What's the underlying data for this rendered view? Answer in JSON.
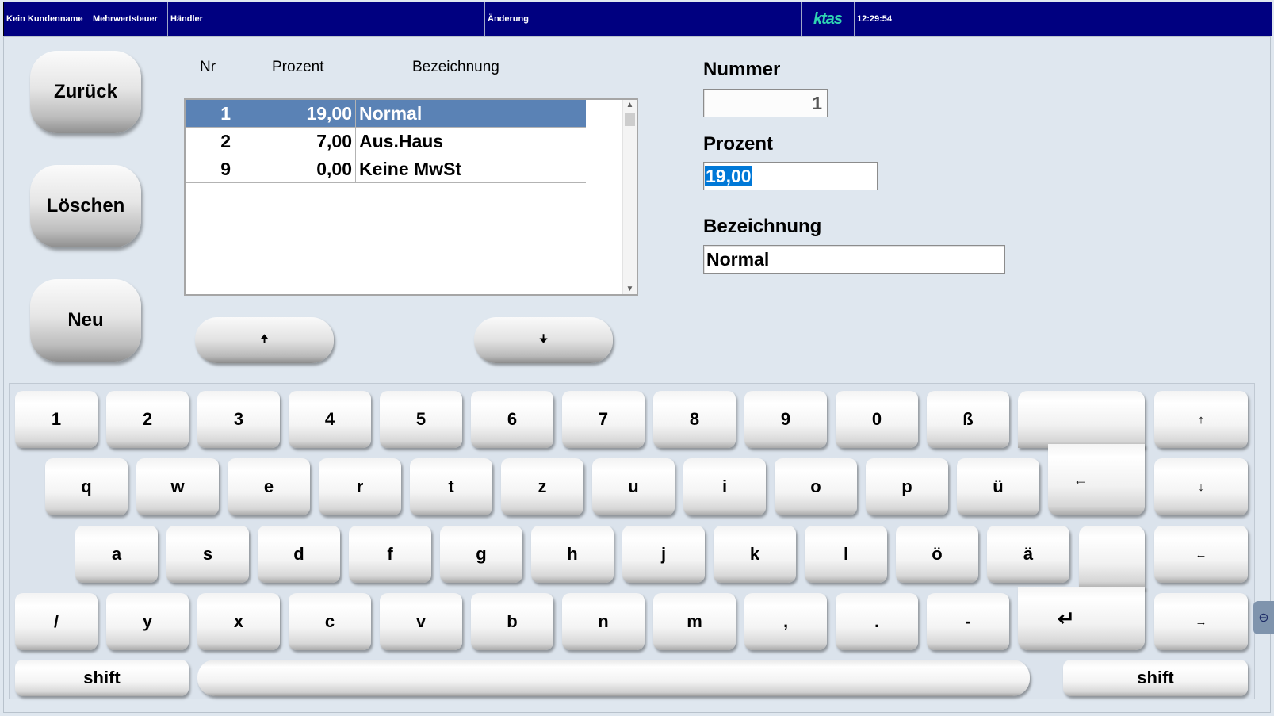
{
  "statusbar": {
    "customer": "Kein Kundenname",
    "module": "Mehrwertsteuer",
    "user": "Händler",
    "mode": "Änderung",
    "logo": "ktas",
    "time": "12:29:54"
  },
  "actions": {
    "back": "Zurück",
    "delete": "Löschen",
    "new": "Neu"
  },
  "list": {
    "columns": {
      "nr": "Nr",
      "percent": "Prozent",
      "name": "Bezeichnung"
    },
    "rows": [
      {
        "nr": "1",
        "percent": "19,00",
        "name": "Normal",
        "selected": true
      },
      {
        "nr": "2",
        "percent": "7,00",
        "name": "Aus.Haus",
        "selected": false
      },
      {
        "nr": "9",
        "percent": "0,00",
        "name": "Keine MwSt",
        "selected": false
      }
    ],
    "scroll_up_glyph": "▲",
    "scroll_down_glyph": "▼",
    "nav_up": "🠉",
    "nav_down": "🠋"
  },
  "form": {
    "number_label": "Nummer",
    "number_value": "1",
    "percent_label": "Prozent",
    "percent_value": "19,00",
    "name_label": "Bezeichnung",
    "name_value": "Normal"
  },
  "keyboard": {
    "row1": [
      "1",
      "2",
      "3",
      "4",
      "5",
      "6",
      "7",
      "8",
      "9",
      "0",
      "ß"
    ],
    "row2": [
      "q",
      "w",
      "e",
      "r",
      "t",
      "z",
      "u",
      "i",
      "o",
      "p",
      "ü"
    ],
    "row3": [
      "a",
      "s",
      "d",
      "f",
      "g",
      "h",
      "j",
      "k",
      "l",
      "ö",
      "ä"
    ],
    "row4": [
      "/",
      "y",
      "x",
      "c",
      "v",
      "b",
      "n",
      "m",
      ",",
      ".",
      "-"
    ],
    "backspace": "←",
    "enter": "↵",
    "arrow_up": "↑",
    "arrow_down": "↓",
    "arrow_left": "←",
    "arrow_right": "→",
    "shift_left": "shift",
    "shift_right": "shift",
    "side_tab": "⊖"
  },
  "colors": {
    "titlebar": "#000080",
    "selection": "#5a82b5",
    "background": "#dfe7ef",
    "logo": "#2fd4b2"
  }
}
